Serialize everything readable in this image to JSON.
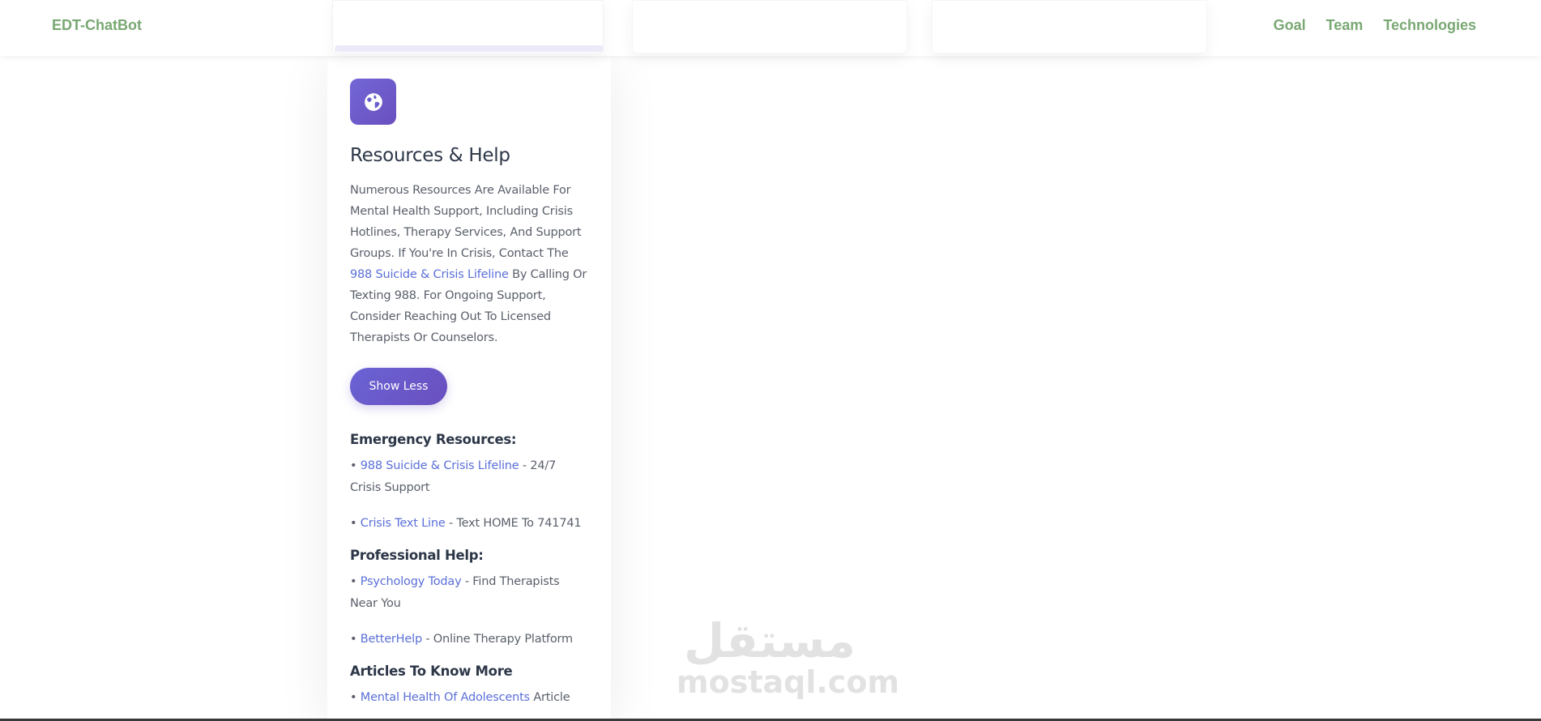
{
  "header": {
    "brand": "EDT-ChatBot",
    "nav": [
      {
        "label": "Goal"
      },
      {
        "label": "Team"
      },
      {
        "label": "Technologies"
      }
    ]
  },
  "card": {
    "icon": "globe-icon",
    "title": "Resources & Help",
    "description": {
      "part1": "Numerous Resources Are Available For Mental Health Support, Including Crisis Hotlines, Therapy Services, And Support Groups. If You're In Crisis, Contact The ",
      "link": "988 Suicide & Crisis Lifeline",
      "part2": " By Calling Or Texting 988. For Ongoing Support, Consider Reaching Out To Licensed Therapists Or Counselors."
    },
    "toggle_label": "Show Less",
    "sections": [
      {
        "heading": "Emergency Resources:",
        "items": [
          {
            "link": "988 Suicide & Crisis Lifeline",
            "text": " - 24/7 Crisis Support"
          },
          {
            "link": "Crisis Text Line",
            "text": " - Text HOME To 741741"
          }
        ]
      },
      {
        "heading": "Professional Help:",
        "items": [
          {
            "link": "Psychology Today",
            "text": " - Find Therapists Near You"
          },
          {
            "link": "BetterHelp",
            "text": " - Online Therapy Platform"
          }
        ]
      },
      {
        "heading": "Articles To Know More",
        "items": [
          {
            "link": "Mental Health Of Adolescents",
            "text": " Article"
          }
        ]
      }
    ]
  },
  "watermark": {
    "arabic": "مستقل",
    "latin": "mostaql.com"
  },
  "colors": {
    "brand_green": "#7aa874",
    "accent_purple": "#6a4fbf",
    "link_blue": "#5a6fd8"
  }
}
